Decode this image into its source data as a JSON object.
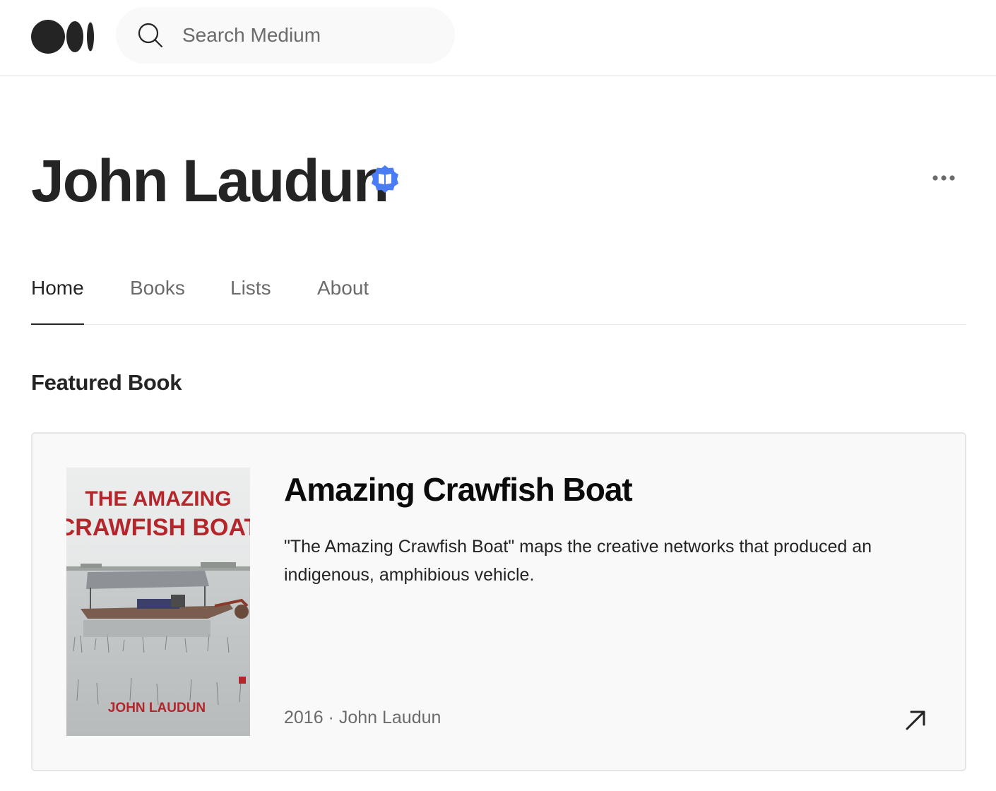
{
  "header": {
    "logo_icon": "medium-logo-icon",
    "search_icon": "search-icon",
    "search_placeholder": "Search Medium"
  },
  "profile": {
    "name": "John Laudun",
    "verified_icon": "verified-book-author-icon",
    "more_icon": "more-icon",
    "accent_color": "#4a7cf5"
  },
  "tabs": [
    {
      "label": "Home",
      "active": true
    },
    {
      "label": "Books",
      "active": false
    },
    {
      "label": "Lists",
      "active": false
    },
    {
      "label": "About",
      "active": false
    }
  ],
  "featured": {
    "section_title": "Featured Book",
    "book": {
      "title": "Amazing Crawfish Boat",
      "description": "\"The Amazing Crawfish Boat\" maps the creative networks that produced an indigenous, amphibious vehicle.",
      "meta": "2016 · John Laudun",
      "link_icon": "arrow-up-right-icon",
      "cover": {
        "title_line1": "THE AMAZING",
        "title_line2": "CRAWFISH BOAT",
        "author": "JOHN LAUDUN",
        "title_color": "#b3262c"
      }
    }
  }
}
